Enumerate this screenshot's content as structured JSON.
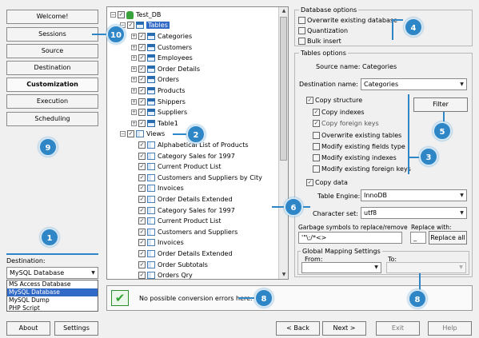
{
  "nav": {
    "items": [
      "Welcome!",
      "Sessions",
      "Source",
      "Destination",
      "Customization",
      "Execution",
      "Scheduling"
    ],
    "active": "Customization"
  },
  "badges": [
    "1",
    "2",
    "3",
    "4",
    "5",
    "6",
    "8",
    "9",
    "10"
  ],
  "destination": {
    "label": "Destination:",
    "selected": "MySQL Database",
    "options": [
      "MS Access Database",
      "MySQL Database",
      "MySQL Dump",
      "PHP Script"
    ],
    "highlighted": "MySQL Database"
  },
  "tree": {
    "root": "Test_DB",
    "tables_label": "Tables",
    "tables": [
      "Categories",
      "Customers",
      "Employees",
      "Order Details",
      "Orders",
      "Products",
      "Shippers",
      "Suppliers",
      "Table1"
    ],
    "views_label": "Views",
    "views": [
      "Alphabetical List of Products",
      "Category Sales for 1997",
      "Current Product List",
      "Customers and Suppliers by City",
      "Invoices",
      "Order Details Extended",
      "Category Sales for 1997",
      "Current Product List",
      "Customers and Suppliers",
      "Invoices",
      "Order Details Extended",
      "Order Subtotals",
      "Orders Qry"
    ]
  },
  "database_options": {
    "title": "Database options",
    "items": [
      "Overwrite existing database",
      "Quantization",
      "Bulk insert"
    ]
  },
  "tables_options": {
    "title": "Tables options",
    "source_name_label": "Source name:",
    "source_name_value": "Categories",
    "destination_name_label": "Destination name:",
    "destination_name_value": "Categories",
    "copy_structure": "Copy structure",
    "copy_indexes": "Copy indexes",
    "copy_foreign_keys": "Copy foreign keys",
    "overwrite_existing_tables": "Overwrite existing tables",
    "modify_existing_fields_type": "Modify existing fields type",
    "modify_existing_indexes": "Modify existing indexes",
    "modify_existing_foreign_keys": "Modify existing foreign keys",
    "filter_button": "Filter",
    "copy_data": "Copy data",
    "table_engine_label": "Table Engine:",
    "table_engine_value": "InnoDB",
    "character_set_label": "Character set:",
    "character_set_value": "utf8",
    "garbage_label": "Garbage symbols to replace/remove",
    "garbage_value": "'\"\\;/*<>",
    "replace_with_label": "Replace with:",
    "replace_with_value": "_",
    "replace_all_button": "Replace all"
  },
  "global_mapping": {
    "title": "Global Mapping Settings",
    "from_label": "From:",
    "to_label": "To:"
  },
  "status": {
    "message": "No possible conversion errors here."
  },
  "bottom": {
    "about": "About",
    "settings": "Settings",
    "back": "< Back",
    "next": "Next >",
    "exit": "Exit",
    "help": "Help"
  },
  "colors": {
    "badge": "#2f86c7",
    "selection": "#3169c6",
    "status_check": "#2ea32e"
  }
}
